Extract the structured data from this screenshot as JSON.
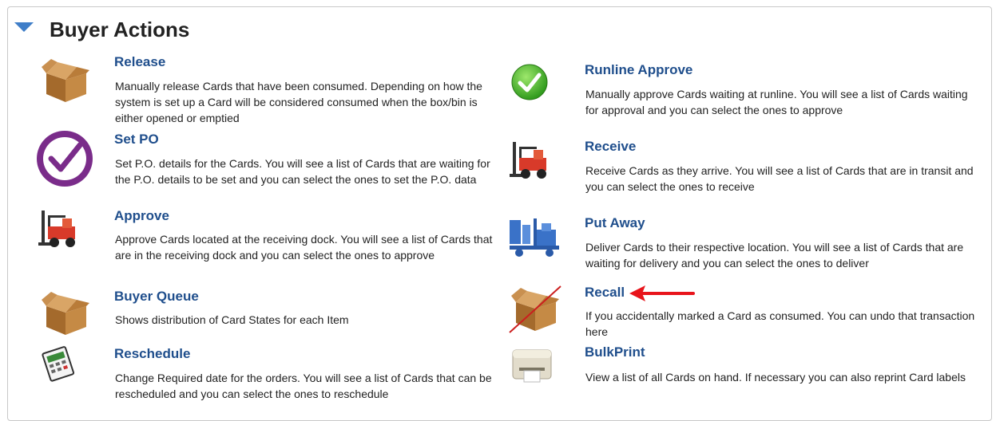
{
  "section": {
    "title": "Buyer Actions",
    "toggle_icon": "caret-down-icon",
    "accent": "#3f7ec8"
  },
  "actions_left": [
    {
      "title": "Release",
      "description": "Manually release Cards that have been consumed. Depending on how the system is set up a Card will be considered consumed when the box/bin is either opened or emptied",
      "icon": "box-icon"
    },
    {
      "title": "Set PO",
      "description": "Set P.O. details for the Cards. You will see a list of Cards that are waiting for the P.O. details to be set and you can select the ones to set the P.O. data",
      "icon": "checkmark-badge-icon"
    },
    {
      "title": "Approve",
      "description": "Approve Cards located at the receiving dock. You will see a list of Cards that are in the receiving dock and you can select the ones to approve",
      "icon": "forklift-icon"
    },
    {
      "title": "Buyer Queue",
      "description": "Shows distribution of Card States for each Item",
      "icon": "box-icon"
    },
    {
      "title": "Reschedule",
      "description": "Change Required date for the orders. You will see a list of Cards that can be rescheduled and you can select the ones to reschedule",
      "icon": "calendar-icon"
    }
  ],
  "actions_right": [
    {
      "title": "Runline Approve",
      "description": "Manually approve Cards waiting at runline. You will see a list of Cards waiting for approval and you can select the ones to approve",
      "icon": "green-check-icon"
    },
    {
      "title": "Receive",
      "description": "Receive Cards as they arrive. You will see a list of Cards that are in transit and you can select the ones to receive",
      "icon": "forklift-icon"
    },
    {
      "title": "Put Away",
      "description": "Deliver Cards to their respective location. You will see a list of Cards that are waiting for delivery and you can select the ones to deliver",
      "icon": "blue-forklift-icon"
    },
    {
      "title": "Recall",
      "description": "If you accidentally marked a Card as consumed. You can undo that transaction here",
      "icon": "crossed-box-icon"
    },
    {
      "title": "BulkPrint",
      "description": "View a list of all Cards on hand. If necessary you can also reprint Card labels",
      "icon": "label-printer-icon"
    }
  ],
  "annotation": {
    "icon": "red-arrow-icon",
    "color": "#e8141b"
  }
}
